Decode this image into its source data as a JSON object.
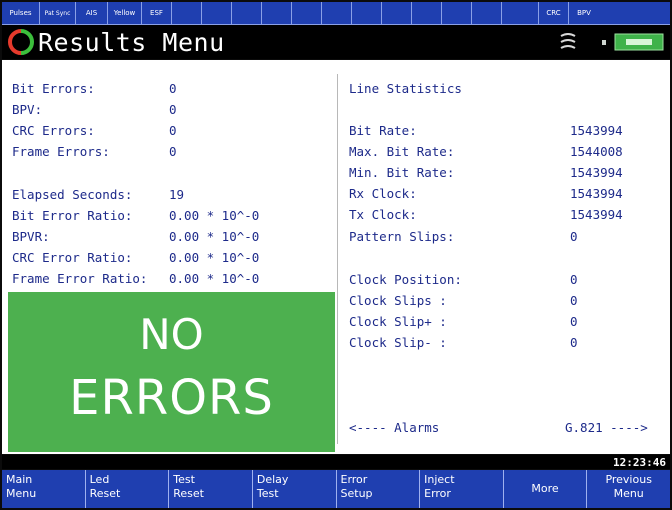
{
  "status_bar": {
    "cells": [
      "Pulses",
      "Pat Sync",
      "AIS",
      "Yellow",
      "ESF",
      "",
      "",
      "",
      "",
      "",
      "",
      "",
      "",
      "",
      "",
      "",
      "",
      "CRC",
      "BPV"
    ]
  },
  "header": {
    "title": "Results Menu"
  },
  "left_panel": {
    "group1": [
      {
        "label": "Bit Errors:",
        "value": "0"
      },
      {
        "label": "BPV:",
        "value": "0"
      },
      {
        "label": "CRC Errors:",
        "value": "0"
      },
      {
        "label": "Frame Errors:",
        "value": "0"
      }
    ],
    "group2": [
      {
        "label": "Elapsed Seconds:",
        "value": "19"
      },
      {
        "label": "Bit Error Ratio:",
        "value": "0.00 * 10^-0"
      },
      {
        "label": "BPVR:",
        "value": "0.00 * 10^-0"
      },
      {
        "label": "CRC Error Ratio:",
        "value": "0.00 * 10^-0"
      },
      {
        "label": "Frame Error Ratio:",
        "value": "0.00 * 10^-0"
      }
    ],
    "banner": {
      "line1": "NO",
      "line2": "ERRORS"
    }
  },
  "right_panel": {
    "heading": "Line Statistics",
    "stats": [
      {
        "label": "Bit Rate:",
        "value": "1543994"
      },
      {
        "label": "Max. Bit Rate:",
        "value": "1544008"
      },
      {
        "label": "Min. Bit Rate:",
        "value": "1543994"
      },
      {
        "label": "Rx Clock:",
        "value": "1543994"
      },
      {
        "label": "Tx Clock:",
        "value": "1543994"
      },
      {
        "label": "Pattern Slips:",
        "value": "0"
      }
    ],
    "clock": [
      {
        "label": "Clock Position:",
        "value": "0"
      },
      {
        "label": "Clock Slips :",
        "value": "0"
      },
      {
        "label": "Clock Slip+ :",
        "value": "0"
      },
      {
        "label": "Clock Slip- :",
        "value": "0"
      }
    ],
    "nav_prev": "<---- Alarms",
    "nav_next": "G.821 ---->"
  },
  "clock_time": "12:23:46",
  "softkeys": [
    {
      "line1": "Main",
      "line2": "Menu"
    },
    {
      "line1": "Led",
      "line2": "Reset"
    },
    {
      "line1": "Test",
      "line2": "Reset"
    },
    {
      "line1": "Delay",
      "line2": "Test"
    },
    {
      "line1": "Error",
      "line2": "Setup"
    },
    {
      "line1": "Inject",
      "line2": "Error"
    },
    {
      "line1": "More",
      "line2": ""
    },
    {
      "line1": "Previous",
      "line2": "Menu"
    }
  ],
  "colors": {
    "accent_blue": "#1f3fb0",
    "banner_green": "#4db04f",
    "text_blue": "#1d2a8a"
  }
}
